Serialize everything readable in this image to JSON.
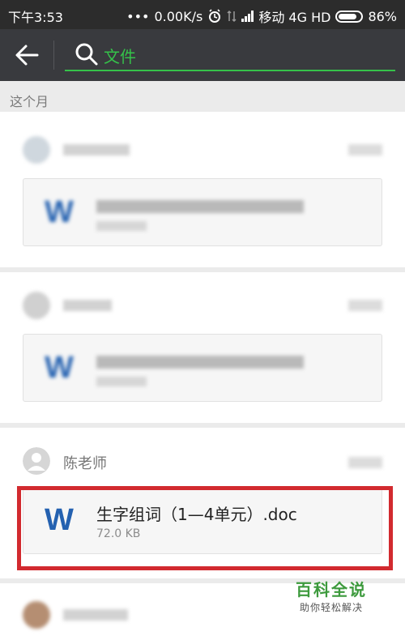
{
  "status_bar": {
    "time": "下午3:53",
    "dots": "•••",
    "net_speed": "0.00K/s",
    "carrier": "移动 4G HD",
    "battery": "86%"
  },
  "search": {
    "query": "文件"
  },
  "section_label": "这个月",
  "messages": [
    {
      "sender": "",
      "file_name": "",
      "file_size": "",
      "blurred": true
    },
    {
      "sender": "",
      "file_name": "",
      "file_size": "",
      "blurred": true
    },
    {
      "sender": "陈老师",
      "file_name": "生字组词（1—4单元）.doc",
      "file_size": "72.0 KB",
      "blurred": false,
      "highlighted": true,
      "file_icon": "W"
    }
  ],
  "watermark": {
    "title": "百科全说",
    "subtitle": "助你轻松解决"
  },
  "colors": {
    "accent_green": "#35c24a",
    "word_blue": "#2461b0",
    "highlight_red": "#d22a2f"
  }
}
